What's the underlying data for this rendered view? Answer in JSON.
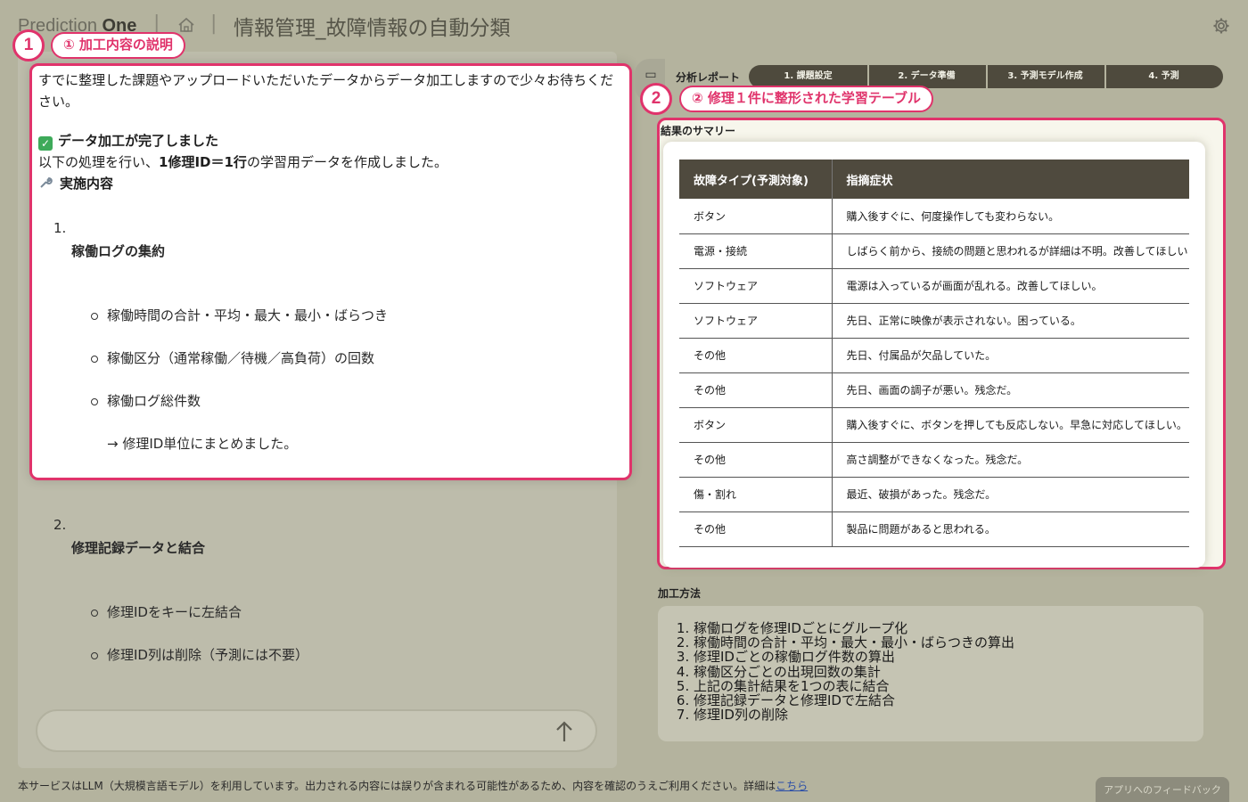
{
  "header": {
    "logo_prefix": "Prediction",
    "logo_suffix": "One",
    "title": "情報管理_故障情報の自動分類"
  },
  "annotations": {
    "badge1_num": "1",
    "badge1_label": "① 加工内容の説明",
    "badge2_num": "2",
    "badge2_label": "② 修理１件に整形された学習テーブル"
  },
  "chat": {
    "intro": "すでに整理した課題やアップロードいただいたデータからデータ加工しますので少々お待ちください。",
    "done_title": "データ加工が完了しました",
    "done_desc_pre": "以下の処理を行い、",
    "done_desc_bold": "1修理ID＝1行",
    "done_desc_post": "の学習用データを作成しました。",
    "section_title": "実施内容",
    "item1_num": "1.",
    "item1_title": "稼働ログの集約",
    "item1_bullets": [
      "稼働時間の合計・平均・最大・最小・ばらつき",
      "稼働区分（通常稼働／待機／高負荷）の回数",
      "稼働ログ総件数"
    ],
    "item1_note": "→ 修理ID単位にまとめました。",
    "item2_num": "2.",
    "item2_title": "修理記録データと結合",
    "item2_bullets": [
      "修理IDをキーに左結合",
      "修理ID列は削除（予測には不要）"
    ]
  },
  "report": {
    "label": "分析レポート",
    "steps": [
      "1. 課題設定",
      "2. データ準備",
      "3. 予測モデル作成",
      "4. 予測"
    ],
    "summary_label": "結果のサマリー",
    "table": {
      "headers": [
        "故障タイプ(予測対象)",
        "指摘症状"
      ],
      "rows": [
        [
          "ボタン",
          "購入後すぐに、何度操作しても変わらない。"
        ],
        [
          "電源・接続",
          "しばらく前から、接続の問題と思われるが詳細は不明。改善してほしい"
        ],
        [
          "ソフトウェア",
          "電源は入っているが画面が乱れる。改善してほしい。"
        ],
        [
          "ソフトウェア",
          "先日、正常に映像が表示されない。困っている。"
        ],
        [
          "その他",
          "先日、付属品が欠品していた。"
        ],
        [
          "その他",
          "先日、画面の調子が悪い。残念だ。"
        ],
        [
          "ボタン",
          "購入後すぐに、ボタンを押しても反応しない。早急に対応してほしい。"
        ],
        [
          "その他",
          "高さ調整ができなくなった。残念だ。"
        ],
        [
          "傷・割れ",
          "最近、破損があった。残念だ。"
        ],
        [
          "その他",
          "製品に問題があると思われる。"
        ]
      ]
    },
    "method_label": "加工方法",
    "methods": [
      "稼働ログを修理IDごとにグループ化",
      "稼働時間の合計・平均・最大・最小・ばらつきの算出",
      "修理IDごとの稼働ログ件数の算出",
      "稼働区分ごとの出現回数の集計",
      "上記の集計結果を1つの表に結合",
      "修理記録データと修理IDで左結合",
      "修理ID列の削除"
    ]
  },
  "footer": {
    "note": "本サービスはLLM（大規模言語モデル）を利用しています。出力される内容には誤りが含まれる可能性があるため、内容を確認のうえご利用ください。詳細は",
    "link": "こちら",
    "feedback": "アプリへのフィードバック"
  },
  "colors": {
    "accent": "#e0336b",
    "background": "#b4b39e",
    "table_header": "#4f4a3e"
  }
}
